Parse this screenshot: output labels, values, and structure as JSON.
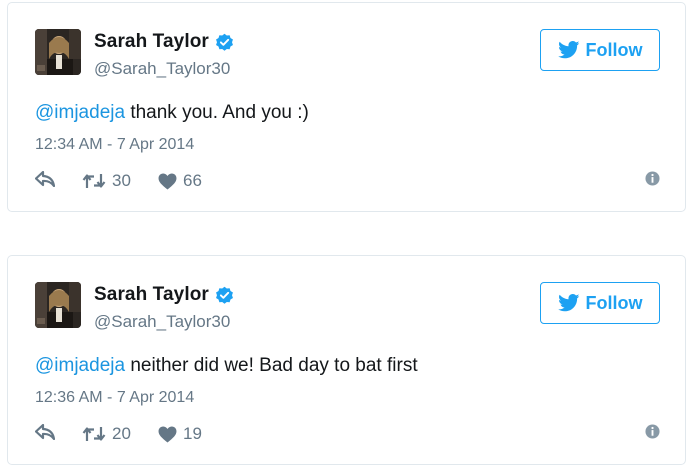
{
  "colors": {
    "accent": "#1da1f2",
    "mention": "#1b95e0",
    "muted": "#657786",
    "border": "#e1e8ed"
  },
  "tweets": [
    {
      "display_name": "Sarah Taylor",
      "handle": "@Sarah_Taylor30",
      "verified": true,
      "follow_label": "Follow",
      "mention": "@imjadeja",
      "text": " thank you. And you :)",
      "timestamp": "12:34 AM - 7 Apr 2014",
      "retweets": "30",
      "likes": "66",
      "icons": [
        "reply-icon",
        "retweet-icon",
        "heart-icon",
        "info-icon",
        "twitter-bird-icon",
        "verified-badge-icon"
      ]
    },
    {
      "display_name": "Sarah Taylor",
      "handle": "@Sarah_Taylor30",
      "verified": true,
      "follow_label": "Follow",
      "mention": "@imjadeja",
      "text": " neither did we! Bad day to bat first",
      "timestamp": "12:36 AM - 7 Apr 2014",
      "retweets": "20",
      "likes": "19",
      "icons": [
        "reply-icon",
        "retweet-icon",
        "heart-icon",
        "info-icon",
        "twitter-bird-icon",
        "verified-badge-icon"
      ]
    }
  ]
}
